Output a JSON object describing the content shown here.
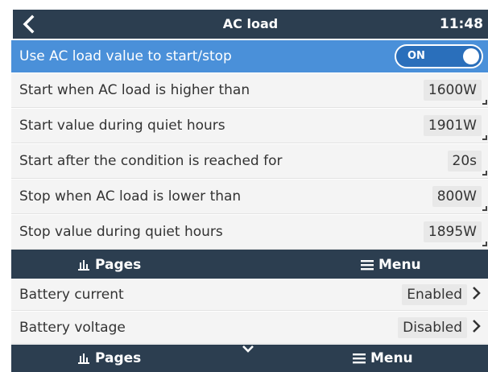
{
  "header": {
    "title": "AC load",
    "time": "11:48"
  },
  "settings": {
    "toggle_row": {
      "label": "Use AC load value to start/stop",
      "state": "ON"
    },
    "rows": [
      {
        "label": "Start when AC load is higher than",
        "value": "1600W"
      },
      {
        "label": "Start value during quiet hours",
        "value": "1901W"
      },
      {
        "label": "Start after the condition is reached for",
        "value": "20s"
      },
      {
        "label": "Stop when AC load is lower than",
        "value": "800W"
      },
      {
        "label": "Stop value during quiet hours",
        "value": "1895W"
      }
    ]
  },
  "nav_top": {
    "pages_label": "Pages",
    "menu_label": "Menu"
  },
  "battery": {
    "rows": [
      {
        "label": "Battery current",
        "value": "Enabled"
      },
      {
        "label": "Battery voltage",
        "value": "Disabled"
      }
    ]
  },
  "nav_bottom": {
    "pages_label": "Pages",
    "menu_label": "Menu"
  },
  "colors": {
    "header_bg": "#2c3e50",
    "selected_row": "#4a90d9",
    "row_bg": "#f4f4f4"
  }
}
